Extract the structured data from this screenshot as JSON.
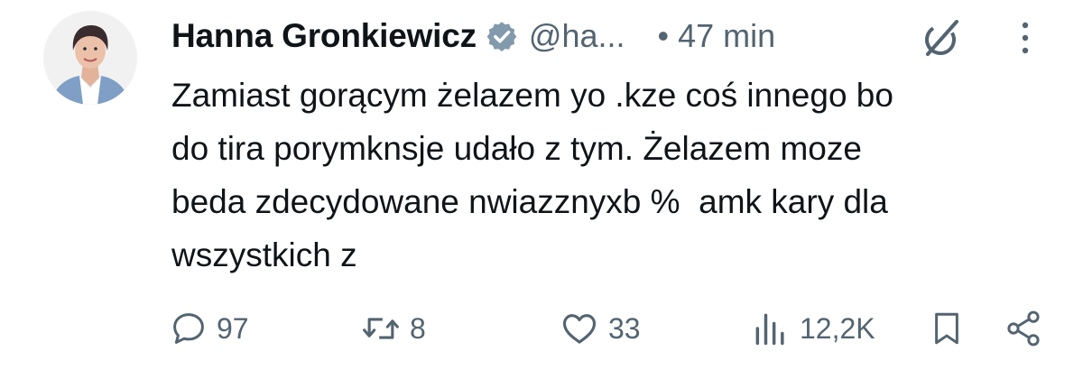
{
  "author": {
    "name": "Hanna Gronkiewicz",
    "handle": "@ha...",
    "verified": true,
    "avatar": "profile-photo"
  },
  "meta": {
    "separator": "•",
    "time": "47 min"
  },
  "tweet": {
    "text": "Zamiast gorącym żelazem yo .kze coś innego bo\ndo tira porymknsje udało z tym. Żelazem moze\nbeda zdecydowane nwiazznyxb %  amk kary dla\nwszystkich z"
  },
  "actions": {
    "reply": "97",
    "retweet": "8",
    "like": "33",
    "views": "12,2K"
  },
  "icons": {
    "grok": "grok-icon",
    "more": "more-vertical-icon",
    "reply": "reply-icon",
    "retweet": "retweet-icon",
    "like": "heart-icon",
    "views": "views-icon",
    "bookmark": "bookmark-icon",
    "share": "share-icon"
  },
  "colors": {
    "text": "#0f1419",
    "muted": "#536471",
    "verified_badge": "#829aab"
  }
}
